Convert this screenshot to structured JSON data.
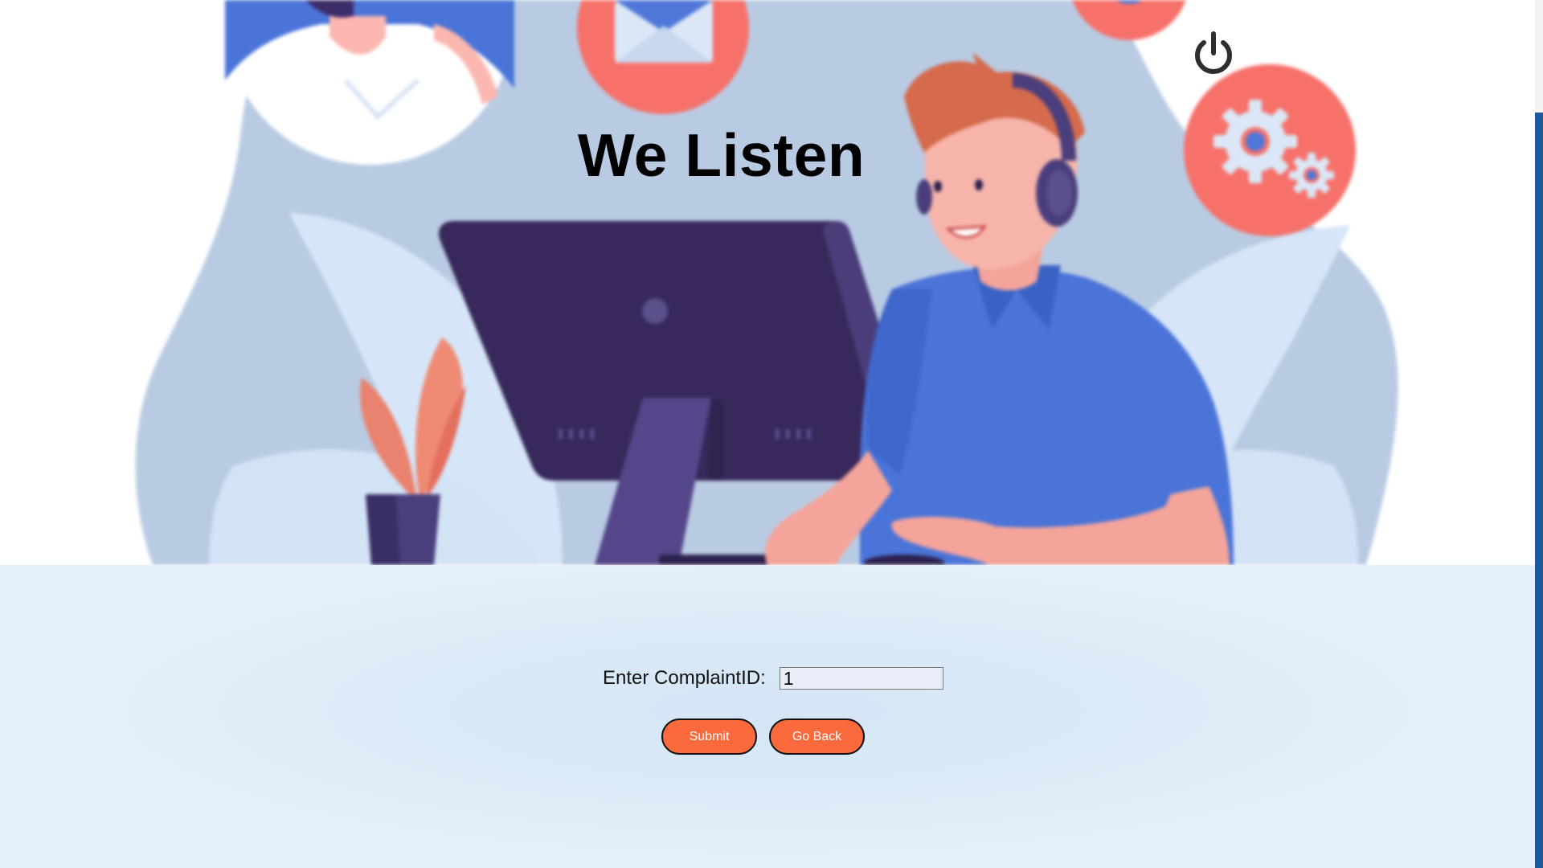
{
  "hero": {
    "heading": "We Listen"
  },
  "toolbar": {
    "power_icon": "power-icon"
  },
  "form": {
    "label": "Enter ComplaintID:",
    "complaint_id_value": "1",
    "submit_label": "Submit",
    "go_back_label": "Go Back"
  },
  "colors": {
    "button_fill": "#fa6a3c",
    "panel_background": "#dbeaf7",
    "scroll_thumb": "#1c5a9c"
  }
}
